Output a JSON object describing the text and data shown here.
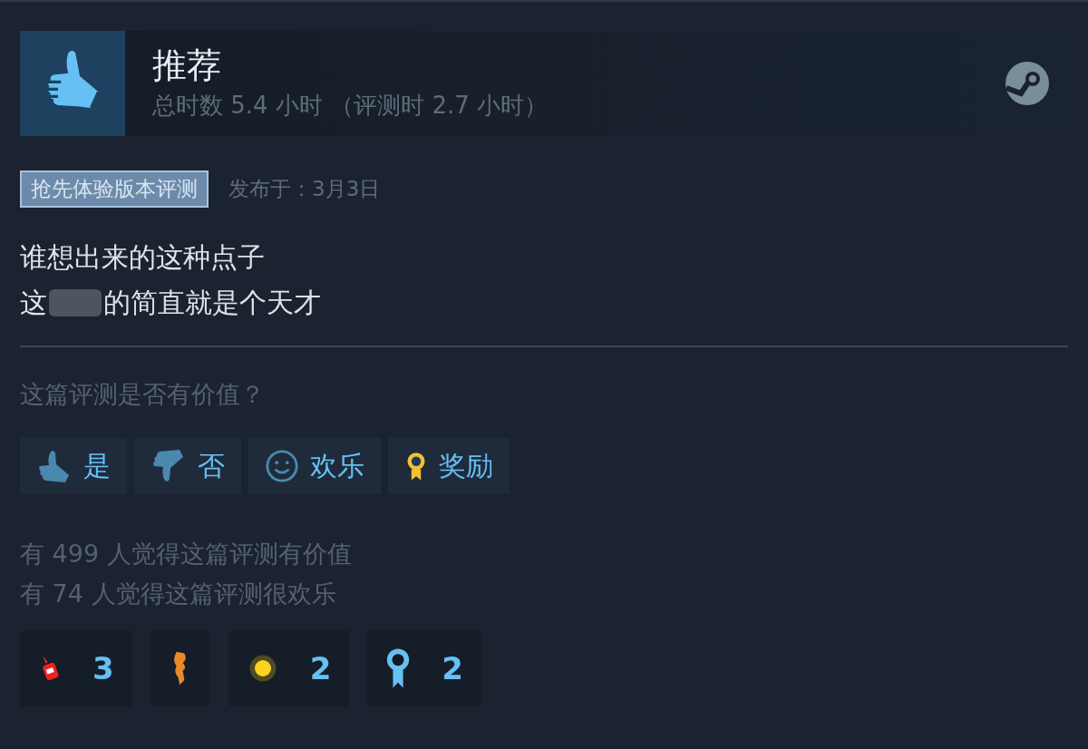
{
  "review": {
    "verdict": "推荐",
    "recommended": true,
    "playtime": "总时数 5.4 小时 （评测时 2.7 小时）",
    "badge": "抢先体验版本评测",
    "posted": "发布于：3月3日",
    "lines": [
      {
        "before": "谁想出来的这种点子",
        "redacted": false
      },
      {
        "before": "这",
        "redacted": true,
        "after": "的简直就是个天才"
      }
    ]
  },
  "helpful": {
    "question": "这篇评测是否有价值？",
    "buttons": [
      {
        "kind": "up",
        "label": "是"
      },
      {
        "kind": "down",
        "label": "否"
      },
      {
        "kind": "funny",
        "label": "欢乐"
      },
      {
        "kind": "award",
        "label": "奖励"
      }
    ],
    "counts": [
      "有 499 人觉得这篇评测有价值",
      "有 74 人觉得这篇评测很欢乐"
    ]
  },
  "awards": [
    {
      "kind": "ketchup",
      "count": "3"
    },
    {
      "kind": "creature"
    },
    {
      "kind": "sun",
      "count": "2"
    },
    {
      "kind": "ribbon",
      "count": "2"
    }
  ]
}
